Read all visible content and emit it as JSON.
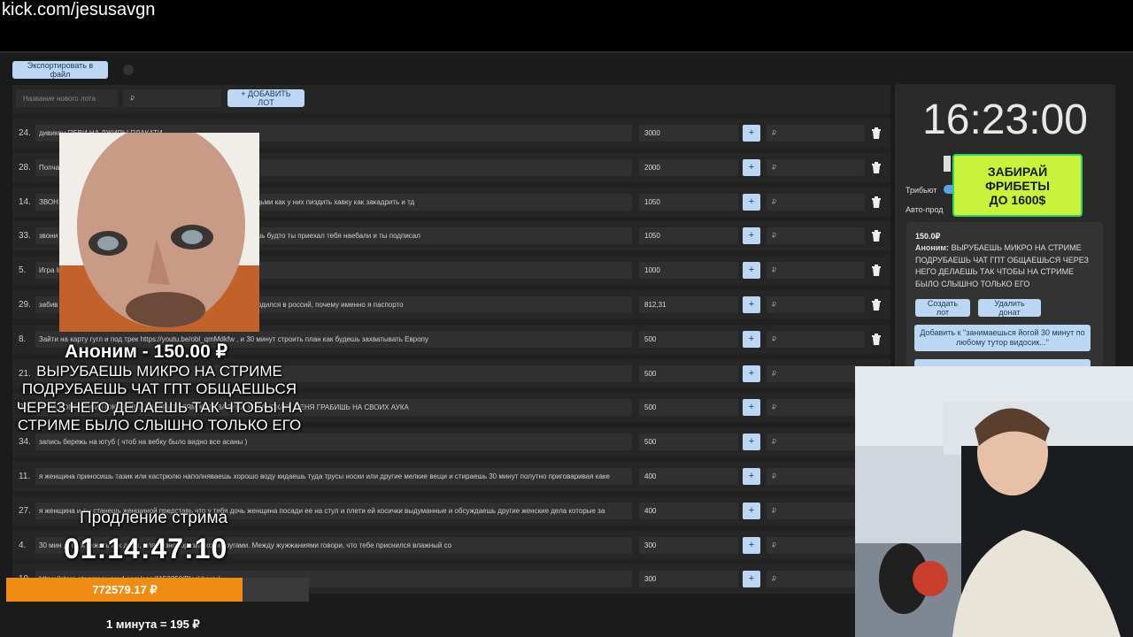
{
  "stream": {
    "channel_url": "kick.com/jesusavgn"
  },
  "toolbar": {
    "export_label": "Экспортировать в файл"
  },
  "add_lot": {
    "name_placeholder": "Название нового лота",
    "price_placeholder": "₽",
    "add_label": "+ ДОБАВИТЬ ЛОТ"
  },
  "lots": [
    {
      "num": "24.",
      "name": "дивикон ПЕВИ НА ЛЖИРЫ ПЛАКАТИ",
      "amount": "3000"
    },
    {
      "num": "28.",
      "name": "Попча",
      "amount": "2000"
    },
    {
      "num": "14.",
      "name": "ЗВОН паук кошка тирранозавр спрашиваешь у него как жить с людьми как у них пиздить хавку как закадрить и тд",
      "amount": "1050"
    },
    {
      "num": "33.",
      "name": "звони ты иноагент спрашиваешь у него помощь помот отыгрываешь будто ты приехал тебя наебали и ты подписал",
      "amount": "1050"
    },
    {
      "num": "5.",
      "name": "Игра In",
      "amount": "1000"
    },
    {
      "num": "29.",
      "name": "забив за что тебе всё это, за что ты иноагент, почему именно ты родился в россий, почему именно я паспорто",
      "amount": "812,31"
    },
    {
      "num": "8.",
      "name": "Зайти на карту гугл и под трек https://youtu.be/obl_qmMdkfw , и 30 минут строить план как будешь захватывать Европу",
      "amount": "500"
    },
    {
      "num": "21.",
      "name": "",
      "amount": "500"
    },
    {
      "num": "22.",
      "name": "ИГРА КОМНАТУ И ПОКАЗЫВАЕШЬ ЗРИТЕЛЯМ КОД, ЗАЛУПА УЕБАНСКАЯ, МЕНЯ ГРАБИШЬ НА СВОИХ АУКА",
      "amount": "500"
    },
    {
      "num": "34.",
      "name": "запись бережь на ютуб ( чтоб на вебку было видно все асаны )",
      "amount": "500"
    },
    {
      "num": "11.",
      "name": "я женщина приносишь тазик или кастрюлю наполняваешь хорошо воду кидаешь туда трусы носки или другие мелкие вещи и стираешь 30 минут полутно приговаривая каке",
      "amount": "400"
    },
    {
      "num": "27.",
      "name": "я женщина и ты станешь женщиной представь что у тебя дочь женщина посади ее на стул и плети ей косички выдуманные и обсуждаешь другие женские дела которые за",
      "amount": "400"
    },
    {
      "num": "4.",
      "name": "30 мин д. С, жужжать как дрон, для разнообразия ходи кругами. Между жужжаниями говори, что тебе приснился влажный со",
      "amount": "300"
    },
    {
      "num": "10.",
      "name": "https://store.steampowered.com/app/1152050/Blackberry/",
      "amount": "300"
    }
  ],
  "row_add_placeholder": "₽",
  "timer": {
    "clock": "16:23:00",
    "tribute_label": "Трибьют",
    "auto_label": "Авто-прод"
  },
  "donation": {
    "amount": "150.0₽",
    "author": "Аноним:",
    "message": "ВЫРУБАЕШЬ МИКРО НА СТРИМЕ ПОДРУБАЕШЬ ЧАТ ГПТ ОБЩАЕШЬСЯ ЧЕРЕЗ НЕГО ДЕЛАЕШЬ ТАК ЧТОБЫ НА СТРИМЕ БЫЛО СЛЫШНО ТОЛЬКО ЕГО",
    "create_lot_label": "Создать лот",
    "delete_label": "Удалить донат",
    "add_to_label": "Добавить к \"занимаешься йогой 30 минут по любому тутор видосик...\""
  },
  "ad_banner": {
    "line1": "ЗАБИРАЙ",
    "line2": "ФРИБЕТЫ",
    "line3": "ДО 1600$"
  },
  "overlay": {
    "donor_head": "Аноним - 150.00 ₽",
    "donor_msg": "ВЫРУБАЕШЬ МИКРО НА СТРИМЕ ПОДРУБАЕШЬ ЧАТ ГПТ ОБЩАЕШЬСЯ ЧЕРЕЗ НЕГО ДЕЛАЕШЬ ТАК ЧТОБЫ НА СТРИМЕ БЫЛО СЛЫШНО ТОЛЬКО ЕГО",
    "extend_title": "Продление стрима",
    "extend_timer": "01:14:47:10",
    "progress_text": "772579.17 ₽",
    "progress_fraction": 0.78,
    "rate": "1 минута = 195 ₽"
  }
}
